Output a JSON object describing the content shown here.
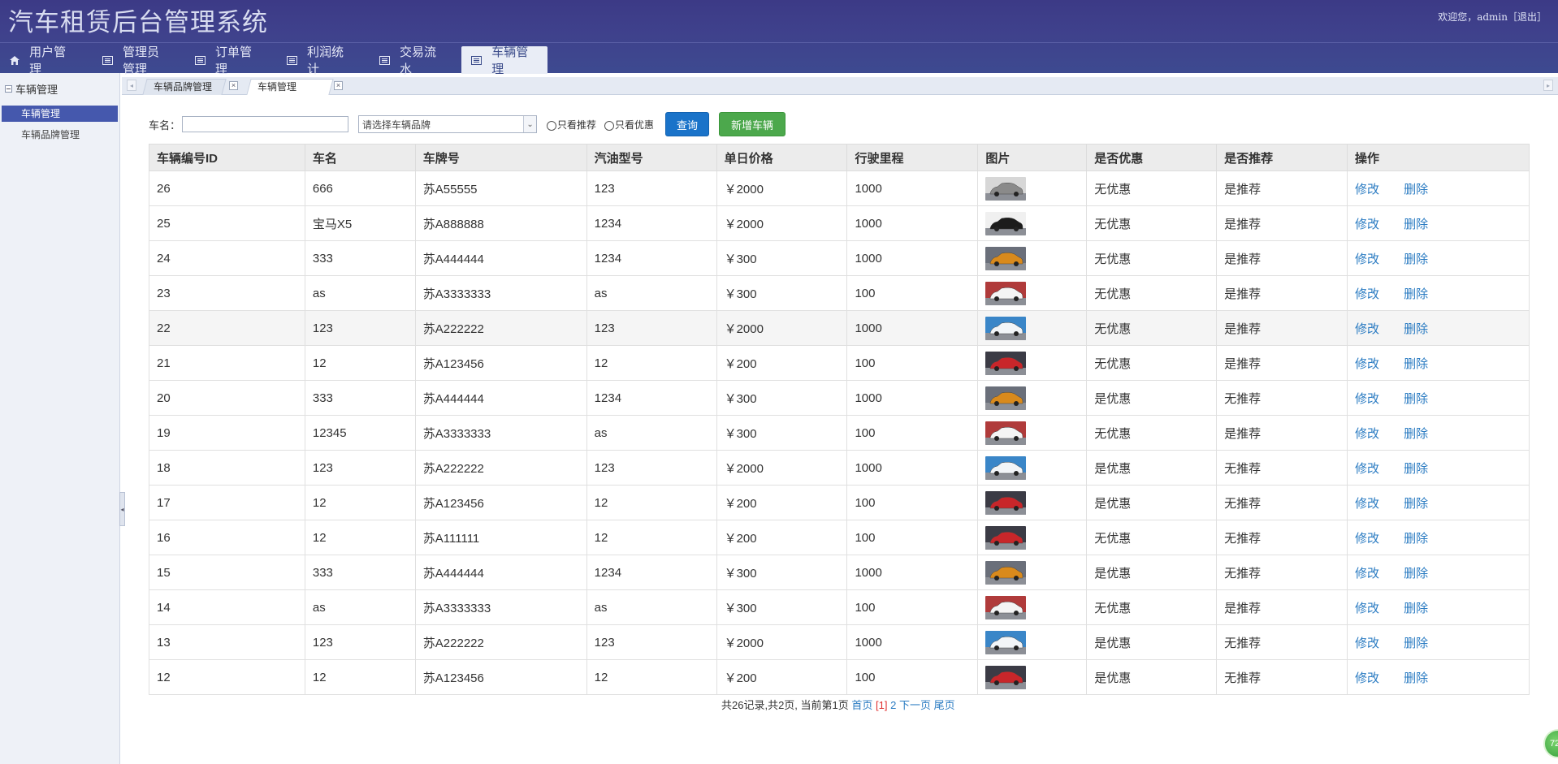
{
  "app": {
    "title": "汽车租赁后台管理系统",
    "welcome": "欢迎您，admin",
    "logout": "［退出］"
  },
  "nav": [
    {
      "label": "用户管理",
      "icon": "home-icon"
    },
    {
      "label": "管理员管理",
      "icon": "list-icon"
    },
    {
      "label": "订单管理",
      "icon": "list-icon"
    },
    {
      "label": "利润统计",
      "icon": "list-icon"
    },
    {
      "label": "交易流水",
      "icon": "list-icon"
    },
    {
      "label": "车辆管理",
      "icon": "list-icon",
      "active": true
    }
  ],
  "sidebar": {
    "title": "车辆管理",
    "items": [
      {
        "label": "车辆管理",
        "active": true
      },
      {
        "label": "车辆品牌管理",
        "active": false
      }
    ]
  },
  "content_tabs": [
    {
      "label": "车辆品牌管理",
      "active": false
    },
    {
      "label": "车辆管理",
      "active": true
    }
  ],
  "search": {
    "name_label": "车名：",
    "name_value": "",
    "brand_placeholder": "请选择车辆品牌",
    "only_recommend": "只看推荐",
    "only_discount": "只看优惠",
    "query_button": "查询",
    "add_button": "新增车辆"
  },
  "table": {
    "columns": [
      "车辆编号ID",
      "车名",
      "车牌号",
      "汽油型号",
      "单日价格",
      "行驶里程",
      "图片",
      "是否优惠",
      "是否推荐",
      "操作"
    ],
    "edit_label": "修改",
    "delete_label": "删除",
    "rows": [
      {
        "id": "26",
        "name": "666",
        "plate": "苏A55555",
        "fuel": "123",
        "price": "￥2000",
        "mileage": "1000",
        "img": "car-gray",
        "discount": "无优惠",
        "recommend": "是推荐"
      },
      {
        "id": "25",
        "name": "宝马X5",
        "plate": "苏A888888",
        "fuel": "1234",
        "price": "￥2000",
        "mileage": "1000",
        "img": "car-black",
        "discount": "无优惠",
        "recommend": "是推荐"
      },
      {
        "id": "24",
        "name": "333",
        "plate": "苏A444444",
        "fuel": "1234",
        "price": "￥300",
        "mileage": "1000",
        "img": "car-orange",
        "discount": "无优惠",
        "recommend": "是推荐"
      },
      {
        "id": "23",
        "name": "as",
        "plate": "苏A3333333",
        "fuel": "as",
        "price": "￥300",
        "mileage": "100",
        "img": "car-white-red",
        "discount": "无优惠",
        "recommend": "是推荐"
      },
      {
        "id": "22",
        "name": "123",
        "plate": "苏A222222",
        "fuel": "123",
        "price": "￥2000",
        "mileage": "1000",
        "img": "car-white-blue",
        "discount": "无优惠",
        "recommend": "是推荐",
        "highlight": true
      },
      {
        "id": "21",
        "name": "12",
        "plate": "苏A123456",
        "fuel": "12",
        "price": "￥200",
        "mileage": "100",
        "img": "car-red",
        "discount": "无优惠",
        "recommend": "是推荐"
      },
      {
        "id": "20",
        "name": "333",
        "plate": "苏A444444",
        "fuel": "1234",
        "price": "￥300",
        "mileage": "1000",
        "img": "car-orange",
        "discount": "是优惠",
        "recommend": "无推荐"
      },
      {
        "id": "19",
        "name": "12345",
        "plate": "苏A3333333",
        "fuel": "as",
        "price": "￥300",
        "mileage": "100",
        "img": "car-white-red",
        "discount": "无优惠",
        "recommend": "是推荐"
      },
      {
        "id": "18",
        "name": "123",
        "plate": "苏A222222",
        "fuel": "123",
        "price": "￥2000",
        "mileage": "1000",
        "img": "car-white-blue",
        "discount": "是优惠",
        "recommend": "无推荐"
      },
      {
        "id": "17",
        "name": "12",
        "plate": "苏A123456",
        "fuel": "12",
        "price": "￥200",
        "mileage": "100",
        "img": "car-red",
        "discount": "是优惠",
        "recommend": "无推荐"
      },
      {
        "id": "16",
        "name": "12",
        "plate": "苏A111111",
        "fuel": "12",
        "price": "￥200",
        "mileage": "100",
        "img": "car-red",
        "discount": "无优惠",
        "recommend": "无推荐"
      },
      {
        "id": "15",
        "name": "333",
        "plate": "苏A444444",
        "fuel": "1234",
        "price": "￥300",
        "mileage": "1000",
        "img": "car-orange",
        "discount": "是优惠",
        "recommend": "无推荐"
      },
      {
        "id": "14",
        "name": "as",
        "plate": "苏A3333333",
        "fuel": "as",
        "price": "￥300",
        "mileage": "100",
        "img": "car-white-red",
        "discount": "无优惠",
        "recommend": "是推荐"
      },
      {
        "id": "13",
        "name": "123",
        "plate": "苏A222222",
        "fuel": "123",
        "price": "￥2000",
        "mileage": "1000",
        "img": "car-white-blue",
        "discount": "是优惠",
        "recommend": "无推荐"
      },
      {
        "id": "12",
        "name": "12",
        "plate": "苏A123456",
        "fuel": "12",
        "price": "￥200",
        "mileage": "100",
        "img": "car-red",
        "discount": "是优惠",
        "recommend": "无推荐"
      }
    ]
  },
  "pager": {
    "summary": "共26记录,共2页, 当前第1页",
    "first": "首页",
    "current": "[1]",
    "page2": "2",
    "next": "下一页",
    "last": "尾页"
  },
  "badge": "72",
  "colors": {
    "header": "#3f418c",
    "accent_blue": "#1a73c9",
    "accent_green": "#4ca84c",
    "link": "#2a7bc2",
    "sidebar_active": "#4558ad"
  }
}
